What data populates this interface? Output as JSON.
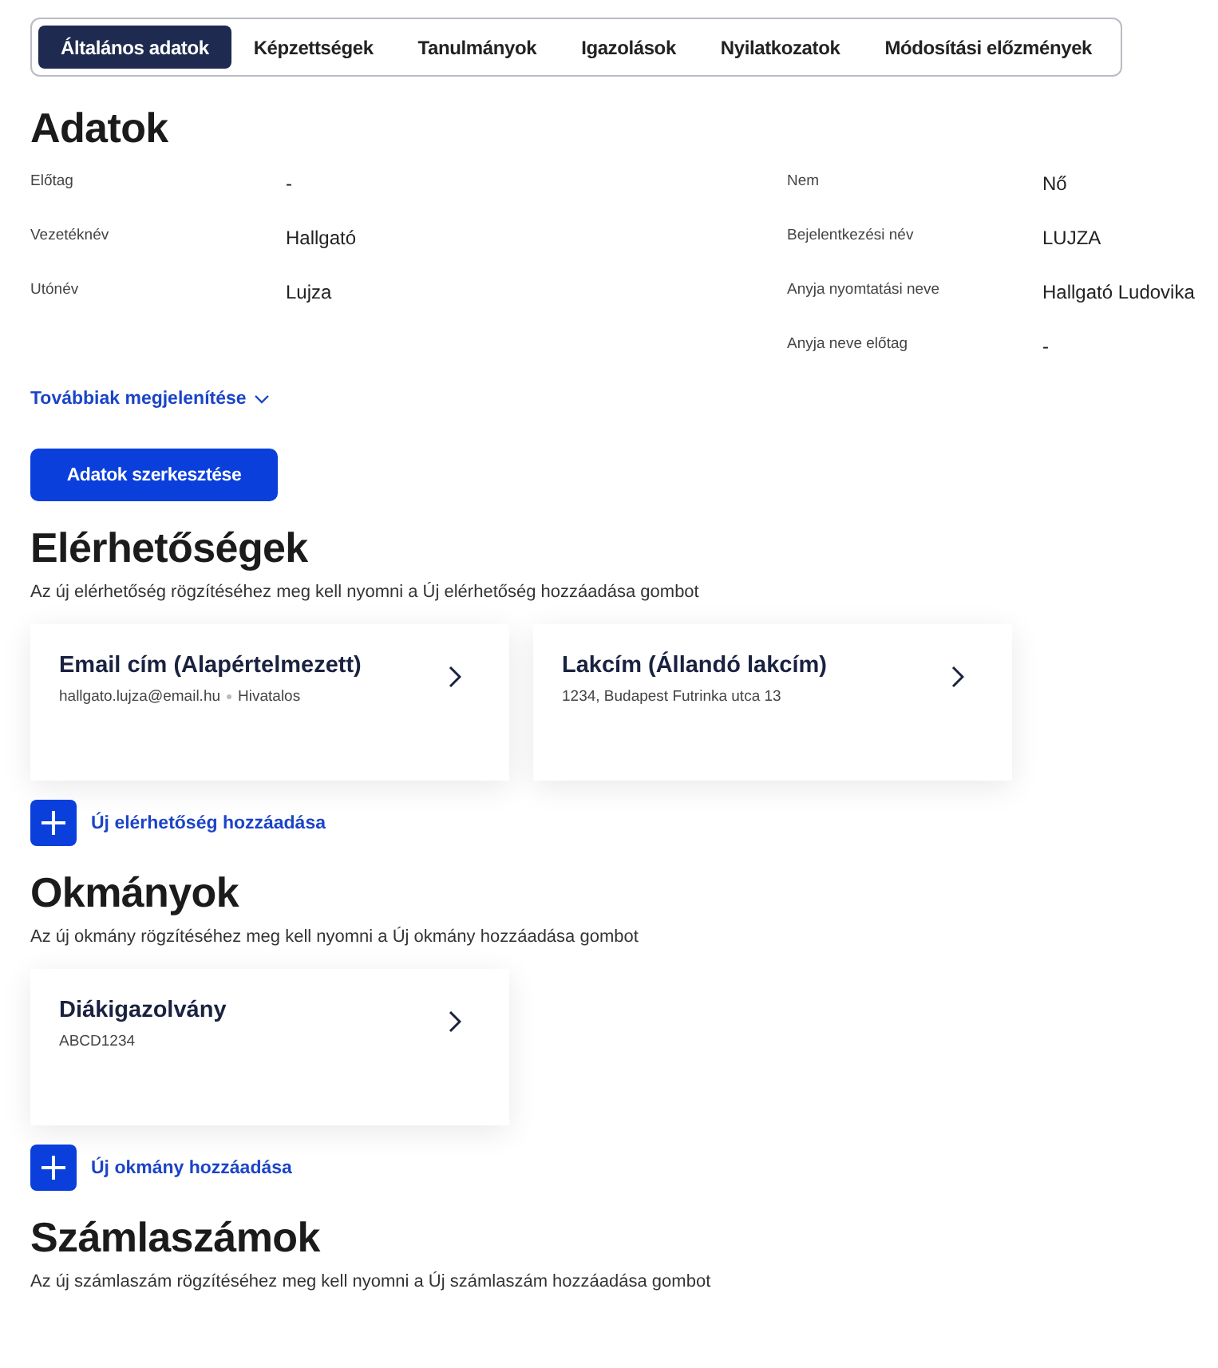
{
  "tabs": [
    {
      "label": "Általános adatok",
      "selected": true
    },
    {
      "label": "Képzettségek",
      "selected": false
    },
    {
      "label": "Tanulmányok",
      "selected": false
    },
    {
      "label": "Igazolások",
      "selected": false
    },
    {
      "label": "Nyilatkozatok",
      "selected": false
    },
    {
      "label": "Módosítási előzmények",
      "selected": false
    }
  ],
  "personal": {
    "title": "Adatok",
    "left_fields": [
      {
        "label": "Előtag",
        "value": "-"
      },
      {
        "label": "Vezetéknév",
        "value": "Hallgató"
      },
      {
        "label": "Utónév",
        "value": "Lujza"
      }
    ],
    "right_fields": [
      {
        "label": "Nem",
        "value": "Nő"
      },
      {
        "label": "Bejelentkezési név",
        "value": "LUJZA"
      },
      {
        "label": "Anyja nyomtatási neve",
        "value": "Hallgató Ludovika"
      },
      {
        "label": "Anyja neve előtag",
        "value": "-"
      }
    ],
    "show_more": "Továbbiak megjelenítése",
    "edit_button": "Adatok szerkesztése"
  },
  "sections": [
    {
      "title": "Elérhetőségek",
      "hint": "Az új elérhetőség rögzítéséhez meg kell nyomni a Új elérhetőség hozzáadása gombot",
      "cards": [
        {
          "title": "Email cím (Alapértelmezett)",
          "details": [
            "hallgato.lujza@email.hu",
            "Hivatalos"
          ]
        },
        {
          "title": "Lakcím (Állandó lakcím)",
          "details": [
            "1234, Budapest Futrinka utca 13"
          ]
        }
      ],
      "add_label": "Új elérhetőség hozzáadása"
    },
    {
      "title": "Okmányok",
      "hint": "Az új okmány rögzítéséhez meg kell nyomni a Új okmány hozzáadása gombot",
      "cards": [
        {
          "title": "Diákigazolvány",
          "details": [
            "ABCD1234"
          ]
        }
      ],
      "add_label": "Új okmány hozzáadása"
    },
    {
      "title": "Számlaszámok",
      "hint": "Az új számlaszám rögzítéséhez meg kell nyomni a Új számlaszám hozzáadása gombot"
    }
  ]
}
